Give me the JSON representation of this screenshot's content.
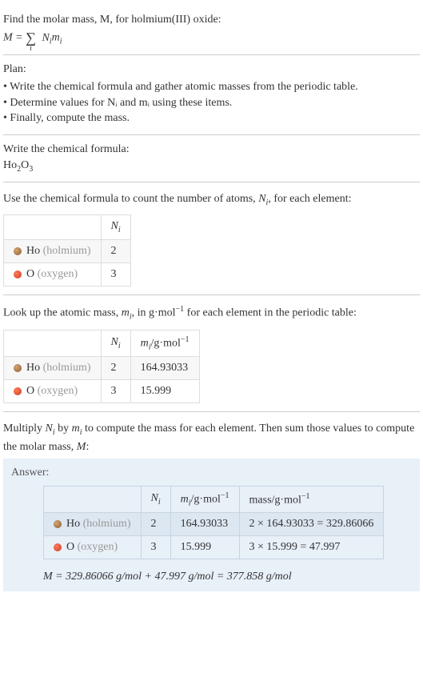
{
  "intro": {
    "line1": "Find the molar mass, M, for holmium(III) oxide:",
    "formula_lhs": "M = ",
    "formula_sum_sub": "i",
    "formula_rhs": "N",
    "formula_rhs_sub1": "i",
    "formula_rhs2": "m",
    "formula_rhs_sub2": "i"
  },
  "plan": {
    "title": "Plan:",
    "items": [
      "Write the chemical formula and gather atomic masses from the periodic table.",
      "Determine values for Nᵢ and mᵢ using these items.",
      "Finally, compute the mass."
    ]
  },
  "chemFormula": {
    "title": "Write the chemical formula:",
    "ho": "Ho",
    "ho_sub": "2",
    "o": "O",
    "o_sub": "3"
  },
  "countAtoms": {
    "title_pre": "Use the chemical formula to count the number of atoms, ",
    "title_var": "N",
    "title_sub": "i",
    "title_post": ", for each element:",
    "header_n": "N",
    "header_n_sub": "i",
    "rows": [
      {
        "dot": "ho-dot",
        "sym": "Ho",
        "name": "(holmium)",
        "n": "2"
      },
      {
        "dot": "o-dot",
        "sym": "O",
        "name": "(oxygen)",
        "n": "3"
      }
    ]
  },
  "atomicMass": {
    "title_pre": "Look up the atomic mass, ",
    "title_var": "m",
    "title_sub": "i",
    "title_mid": ", in g·mol",
    "title_sup": "−1",
    "title_post": " for each element in the periodic table:",
    "header_n": "N",
    "header_n_sub": "i",
    "header_m": "m",
    "header_m_sub": "i",
    "header_m_unit": "/g·mol",
    "header_m_sup": "−1",
    "rows": [
      {
        "dot": "ho-dot",
        "sym": "Ho",
        "name": "(holmium)",
        "n": "2",
        "m": "164.93033"
      },
      {
        "dot": "o-dot",
        "sym": "O",
        "name": "(oxygen)",
        "n": "3",
        "m": "15.999"
      }
    ]
  },
  "multiply": {
    "title_pre": "Multiply ",
    "n_var": "N",
    "n_sub": "i",
    "title_by": " by ",
    "m_var": "m",
    "m_sub": "i",
    "title_mid": " to compute the mass for each element. Then sum those values to compute the molar mass, ",
    "M_var": "M",
    "title_post": ":"
  },
  "answer": {
    "label": "Answer:",
    "header_n": "N",
    "header_n_sub": "i",
    "header_m": "m",
    "header_m_sub": "i",
    "header_m_unit": "/g·mol",
    "header_m_sup": "−1",
    "header_mass": "mass/g·mol",
    "header_mass_sup": "−1",
    "rows": [
      {
        "dot": "ho-dot",
        "sym": "Ho",
        "name": "(holmium)",
        "n": "2",
        "m": "164.93033",
        "mass": "2 × 164.93033 = 329.86066"
      },
      {
        "dot": "o-dot",
        "sym": "O",
        "name": "(oxygen)",
        "n": "3",
        "m": "15.999",
        "mass": "3 × 15.999 = 47.997"
      }
    ],
    "final": "M = 329.86066 g/mol + 47.997 g/mol = 377.858 g/mol"
  }
}
